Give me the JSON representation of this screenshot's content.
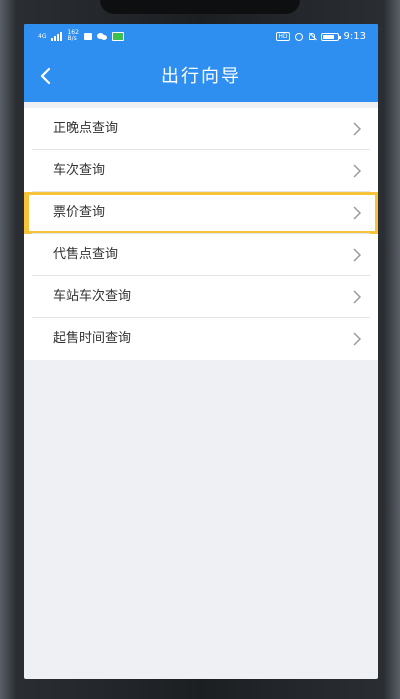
{
  "statusbar": {
    "network_label": "4G",
    "speed_value": "162",
    "speed_unit": "B/s",
    "hd_label": "HD",
    "battery_level": "80",
    "time": "9:13"
  },
  "header": {
    "title": "出行向导"
  },
  "menu": {
    "items": [
      {
        "label": "正晚点查询"
      },
      {
        "label": "车次查询"
      },
      {
        "label": "票价查询"
      },
      {
        "label": "代售点查询"
      },
      {
        "label": "车站车次查询"
      },
      {
        "label": "起售时间查询"
      }
    ],
    "highlighted_index": 2
  },
  "colors": {
    "primary": "#2f8ff0",
    "highlight": "#f7c33b",
    "background": "#eff0f4"
  }
}
